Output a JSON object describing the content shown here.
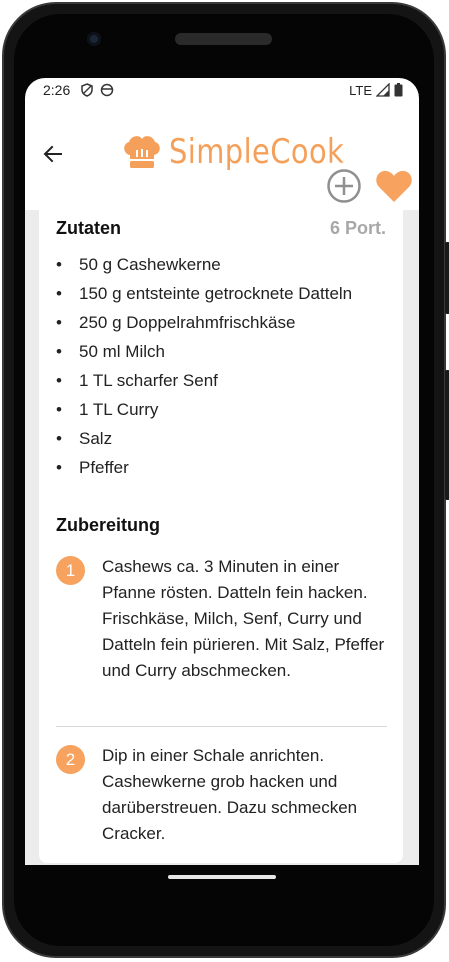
{
  "status_bar": {
    "time": "2:26",
    "network": "LTE"
  },
  "app": {
    "name": "SimpleCook"
  },
  "ingredients": {
    "title": "Zutaten",
    "portions": "6 Port.",
    "items": [
      "50 g Cashewkerne",
      "150 g entsteinte getrocknete Datteln",
      "250 g Doppelrahmfrischkäse",
      "50 ml Milch",
      "1 TL scharfer Senf",
      "1 TL Curry",
      "Salz",
      "Pfeffer"
    ]
  },
  "preparation": {
    "title": "Zubereitung",
    "steps": [
      {
        "number": "1",
        "text": "Cashews ca. 3 Minuten in einer Pfanne rösten. Datteln fein hacken. Frischkäse, Milch, Senf, Curry und Datteln fein pürieren. Mit Salz, Pfeffer und Curry abschmecken."
      },
      {
        "number": "2",
        "text": "Dip in einer Schale anrichten. Cashewkerne grob hacken und darüberstreuen. Dazu schmecken Cracker."
      }
    ]
  },
  "colors": {
    "accent": "#f7a25e",
    "portions_gray": "#a8a8a8"
  },
  "icons": [
    "back-arrow-icon",
    "chef-hat-icon",
    "add-circle-icon",
    "heart-icon",
    "shield-icon",
    "face-icon",
    "signal-icon",
    "battery-icon"
  ]
}
